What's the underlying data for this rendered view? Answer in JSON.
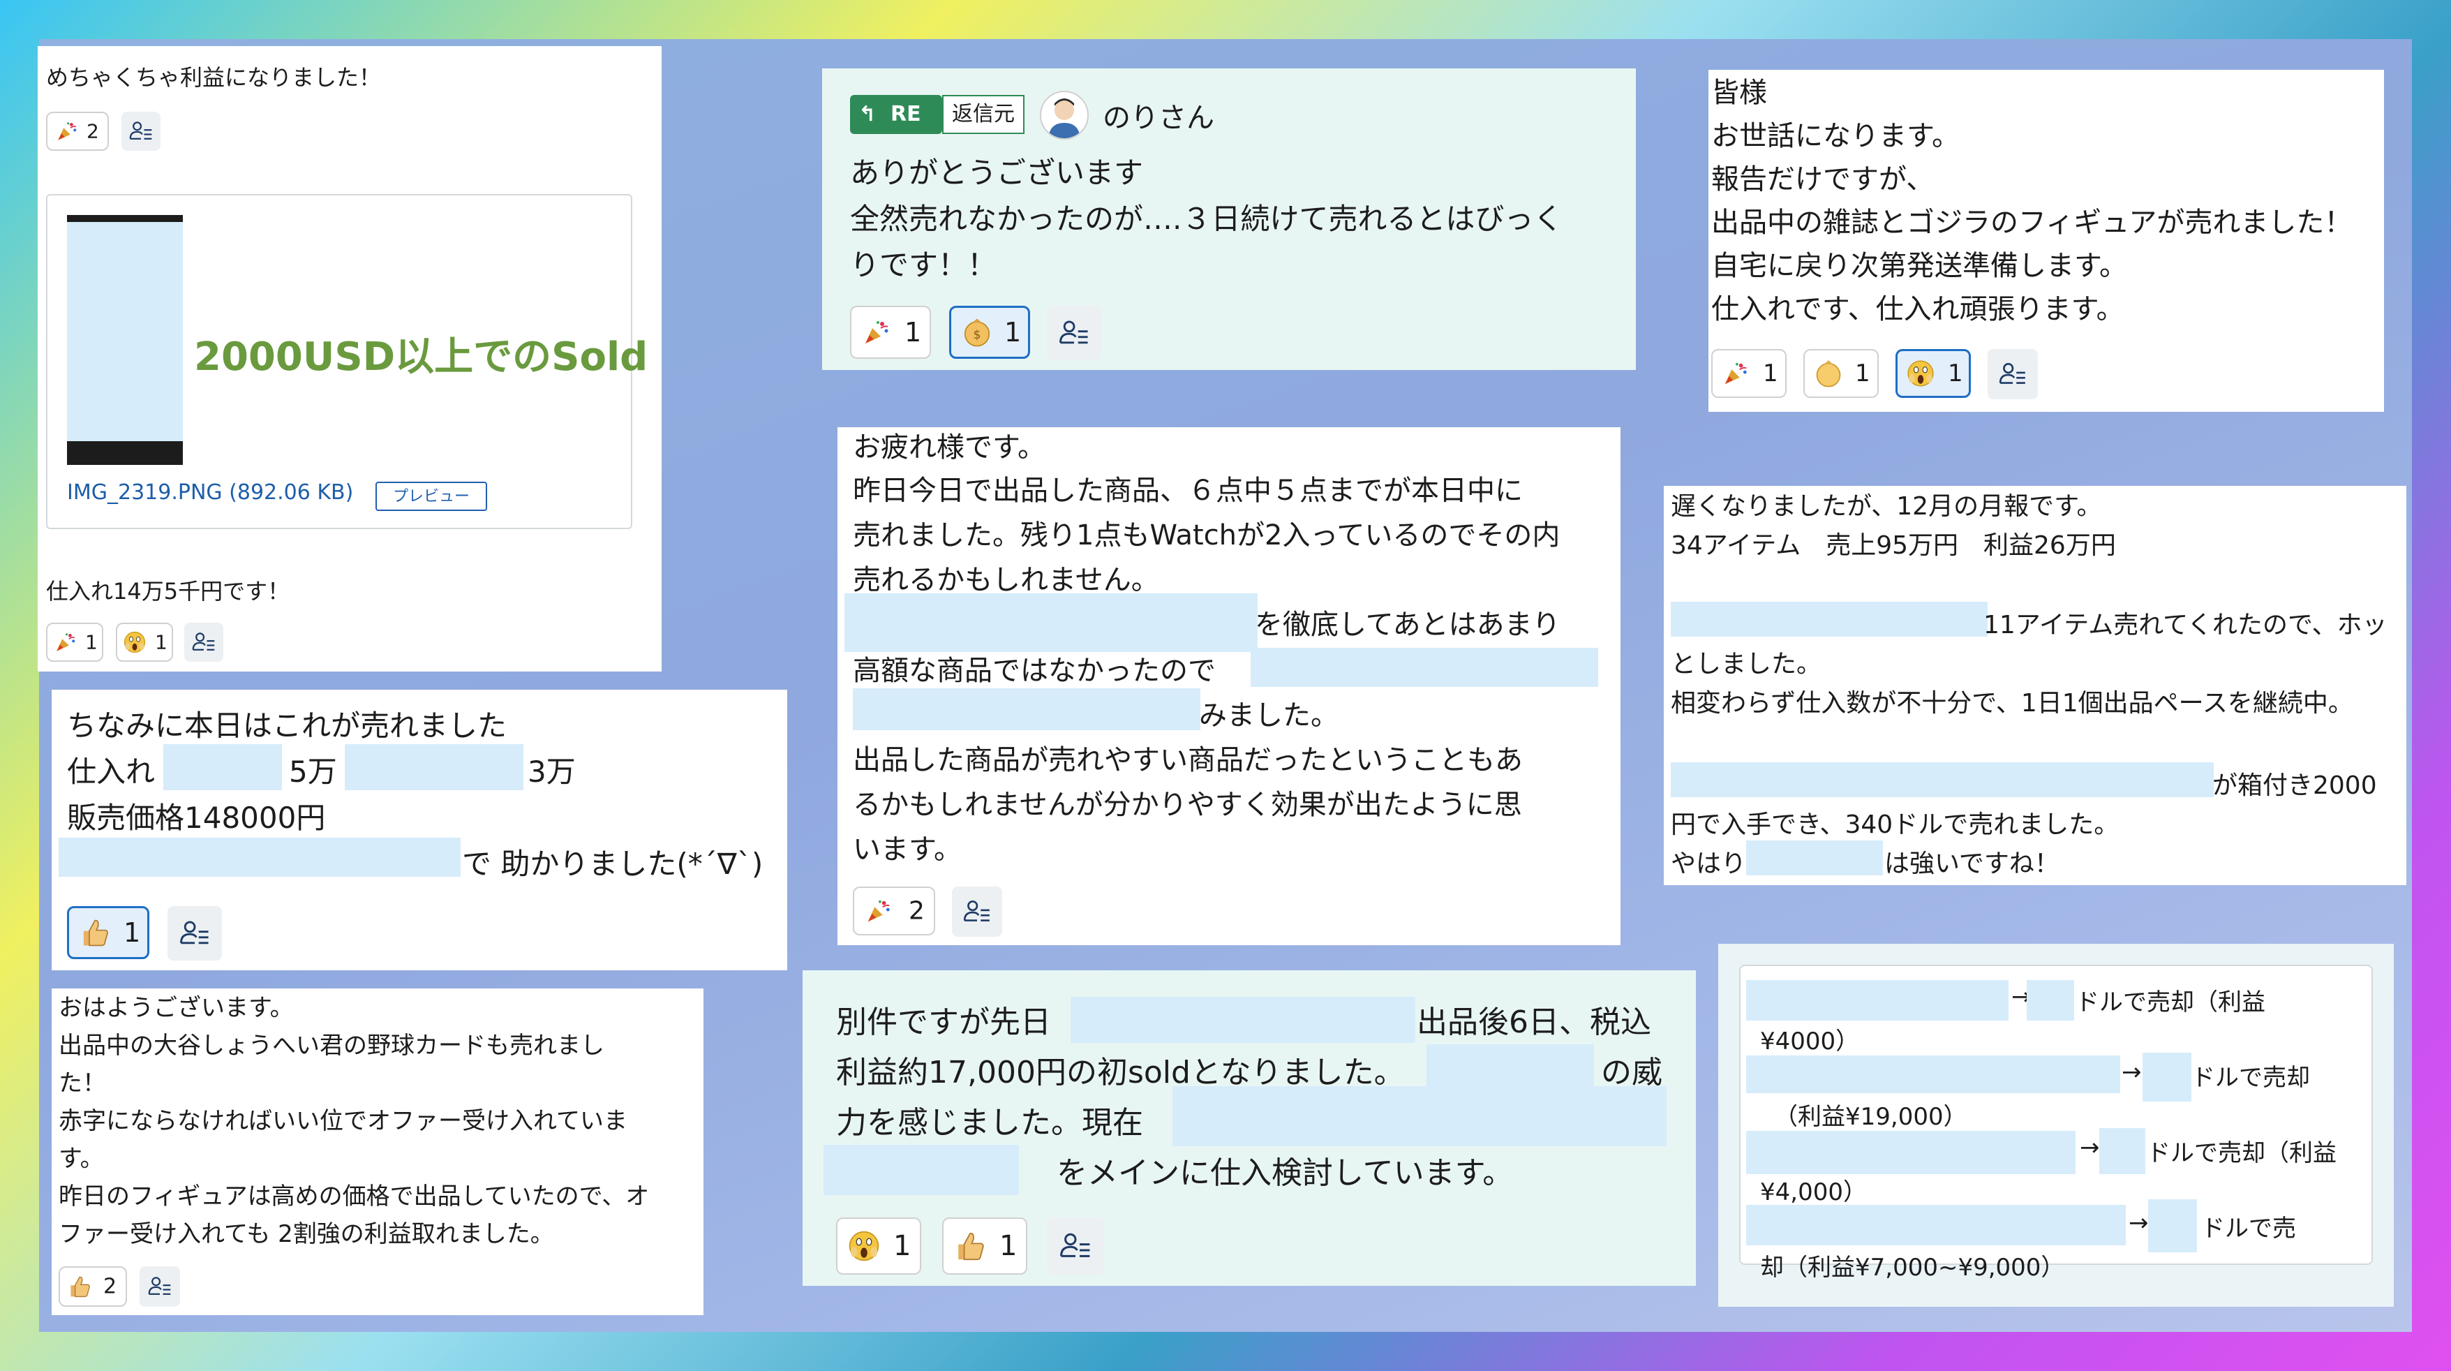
{
  "card1": {
    "line1": "めちゃくちゃ利益になりました！",
    "r1_count": "2",
    "attachment": {
      "overlay_text": "2000USD以上でのSold",
      "filename": "IMG_2319.PNG (892.06 KB)",
      "preview_label": "プレビュー"
    },
    "line2": "仕入れ14万5千円です！",
    "r2a_count": "1",
    "r2b_count": "1"
  },
  "card2": {
    "re_label": "RE",
    "reply_label": "返信元",
    "username": "のりさん",
    "lines": [
      "ありがとうございます",
      "全然売れなかったのが….３日続けて売れるとはびっく",
      "りです！！"
    ],
    "r1_count": "1",
    "r2_count": "1"
  },
  "card3": {
    "lines": [
      "皆様",
      "お世話になります。",
      "報告だけですが、",
      "出品中の雑誌とゴジラのフィギュアが売れました！",
      "自宅に戻り次第発送準備します。",
      "仕入れです、仕入れ頑張ります。"
    ],
    "r1_count": "1",
    "r2_count": "1",
    "r3_count": "1"
  },
  "card4": {
    "l1": "ちなみに本日はこれが売れました",
    "l2a": "仕入れ",
    "l2b": "5万",
    "l2c": "3万",
    "l3": "販売価格148000円",
    "l4": "で 助かりました(*´∇`)",
    "r1_count": "1"
  },
  "card5": {
    "l1": "お疲れ様です。",
    "l2": "昨日今日で出品した商品、６点中５点までが本日中に",
    "l3": "売れました。残り1点もWatchが2入っているのでその内",
    "l4": "売れるかもしれません。",
    "l5": "を徹底してあとはあまり",
    "l6": "高額な商品ではなかったので",
    "l7": "みました。",
    "l8": "出品した商品が売れやすい商品だったということもあ",
    "l9": "るかもしれませんが分かりやすく効果が出たように思",
    "l10": "います。",
    "r1_count": "2"
  },
  "card6": {
    "l1": "遅くなりましたが、12月の月報です。",
    "l2": "34アイテム　売上95万円　利益26万円",
    "l3": "11アイテム売れてくれたので、ホッ",
    "l4": "としました。",
    "l5": "相変わらず仕入数が不十分で、1日1個出品ペースを継続中。",
    "l6": "が箱付き2000",
    "l7": "円で入手でき、340ドルで売れました。",
    "l8a": "やはり",
    "l8b": "は強いですね！"
  },
  "card7": {
    "lines": [
      "おはようございます。",
      "出品中の大谷しょうへい君の野球カードも売れまし",
      "た！",
      "赤字にならなければいい位でオファー受け入れていま",
      "す。",
      "昨日のフィギュアは高めの価格で出品していたので、オ",
      "ファー受け入れても 2割強の利益取れました。"
    ],
    "r1_count": "2"
  },
  "card8": {
    "l1a": "別件ですが先日",
    "l1b": "出品後6日、税込",
    "l2a": "利益約17,000円の初soldとなりました。",
    "l2b": "の威",
    "l3": "力を感じました。現在",
    "l4": "をメインに仕入検討しています。",
    "r1_count": "1",
    "r2_count": "1"
  },
  "card9": {
    "arrow": "→",
    "l1": "ドルで売却（利益",
    "l2": "¥4000）",
    "l3": "ドルで売却",
    "l4": "（利益¥19,000）",
    "l5": "ドルで売却（利益",
    "l6": "¥4,000）",
    "l7": "ドルで売",
    "l8": "却（利益¥7,000~¥9,000）"
  }
}
